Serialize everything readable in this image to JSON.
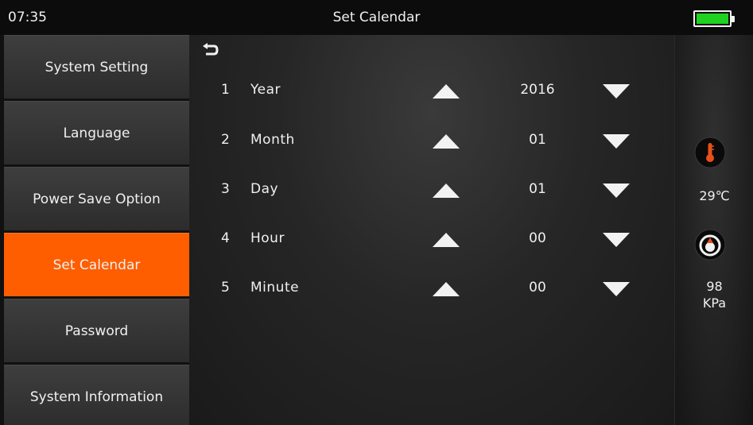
{
  "statusbar": {
    "time": "07:35",
    "title": "Set Calendar",
    "battery_level": 1.0
  },
  "sidebar": {
    "items": [
      {
        "label": "System Setting",
        "active": false
      },
      {
        "label": "Language",
        "active": false
      },
      {
        "label": "Power Save Option",
        "active": false
      },
      {
        "label": "Set Calendar",
        "active": true
      },
      {
        "label": "Password",
        "active": false
      },
      {
        "label": "System Information",
        "active": false
      }
    ]
  },
  "calendar": {
    "rows": [
      {
        "index": "1",
        "label": "Year",
        "value": "2016"
      },
      {
        "index": "2",
        "label": "Month",
        "value": "01"
      },
      {
        "index": "3",
        "label": "Day",
        "value": "01"
      },
      {
        "index": "4",
        "label": "Hour",
        "value": "00"
      },
      {
        "index": "5",
        "label": "Minute",
        "value": "00"
      }
    ]
  },
  "sensors": {
    "temperature": "29℃",
    "pressure_value": "98",
    "pressure_unit": "KPa"
  },
  "colors": {
    "accent": "#ff5e00",
    "battery": "#1fd21f",
    "thermometer": "#e8501a"
  },
  "icons": {
    "back": "back-arrow-icon",
    "up": "up-triangle-icon",
    "down": "down-triangle-icon",
    "temperature": "thermometer-icon",
    "pressure": "pressure-gauge-icon",
    "battery": "battery-icon"
  }
}
